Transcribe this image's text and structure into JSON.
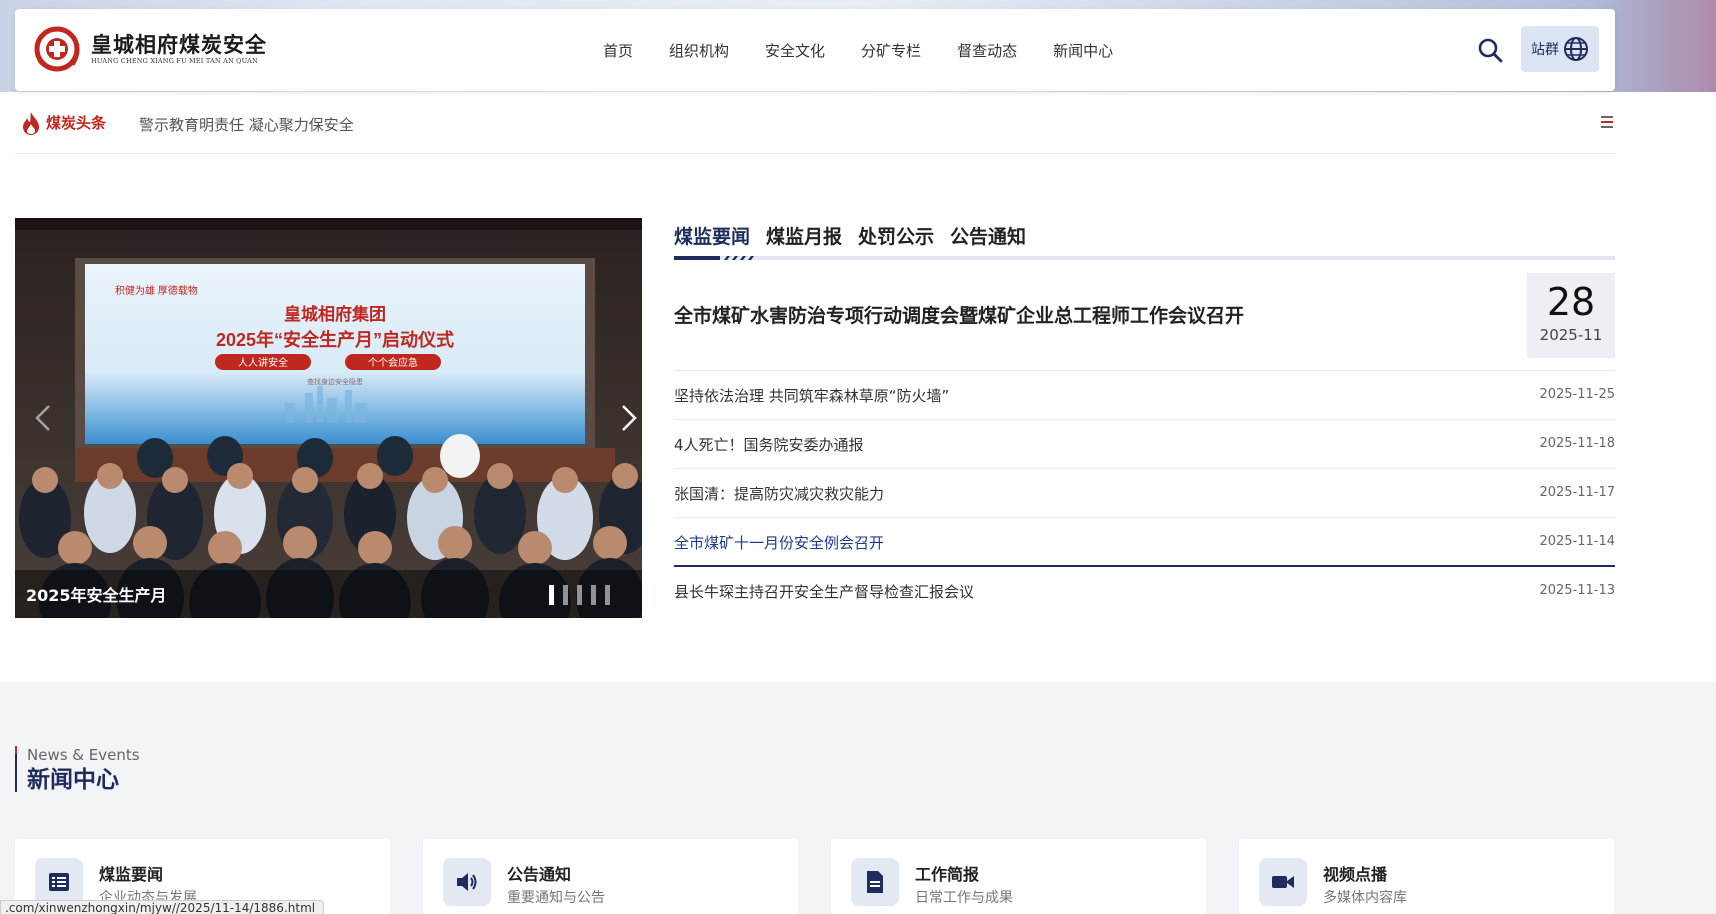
{
  "header": {
    "logo_cn": "皇城相府煤炭安全",
    "logo_en": "HUANG CHENG XIANG FU MEI TAN AN QUAN",
    "nav": [
      "首页",
      "组织机构",
      "安全文化",
      "分矿专栏",
      "督查动态",
      "新闻中心"
    ],
    "search_icon": "search-icon",
    "site_label": "站群",
    "site_icon": "globe-icon"
  },
  "headline": {
    "label": "煤炭头条",
    "text": "警示教育明责任 凝心聚力保安全"
  },
  "carousel": {
    "caption": "2025年安全生产月",
    "slides": 5,
    "active_slide": 1,
    "banner_top": "积健为雄  厚德载物",
    "banner_org": "皇城相府集团",
    "banner_main": "2025年“安全生产月”启动仪式",
    "banner_pill_1": "人人讲安全",
    "banner_pill_2": "个个会应急",
    "banner_small": "查找身边安全隐患"
  },
  "news": {
    "tabs": [
      "煤监要闻",
      "煤监月报",
      "处罚公示",
      "公告通知"
    ],
    "active_tab": "煤监要闻",
    "featured": {
      "title": "全市煤矿水害防治专项行动调度会暨煤矿企业总工程师工作会议召开",
      "day": "28",
      "year_month": "2025-11"
    },
    "items": [
      {
        "title": "坚持依法治理 共同筑牢森林草原“防火墙”",
        "date": "2025-11-25"
      },
      {
        "title": "4人死亡！国务院安委办通报",
        "date": "2025-11-18"
      },
      {
        "title": "张国清：提高防灾减灾救灾能力",
        "date": "2025-11-17"
      },
      {
        "title": "全市煤矿十一月份安全例会召开",
        "date": "2025-11-14"
      },
      {
        "title": "县长牛琛主持召开安全生产督导检查汇报会议",
        "date": "2025-11-13"
      }
    ]
  },
  "section": {
    "en": "News & Events",
    "cn": "新闻中心",
    "cards": [
      {
        "title": "煤监要闻",
        "sub": "企业动态与发展",
        "icon": "list-icon"
      },
      {
        "title": "公告通知",
        "sub": "重要通知与公告",
        "icon": "speaker-icon"
      },
      {
        "title": "工作简报",
        "sub": "日常工作与成果",
        "icon": "document-icon"
      },
      {
        "title": "视频点播",
        "sub": "多媒体内容库",
        "icon": "video-icon"
      }
    ]
  },
  "status_url": ".com/xinwenzhongxin/mjyw//2025/11-14/1886.html",
  "colors": {
    "brand_navy": "#1e2d5e",
    "brand_red": "#c0281f"
  }
}
